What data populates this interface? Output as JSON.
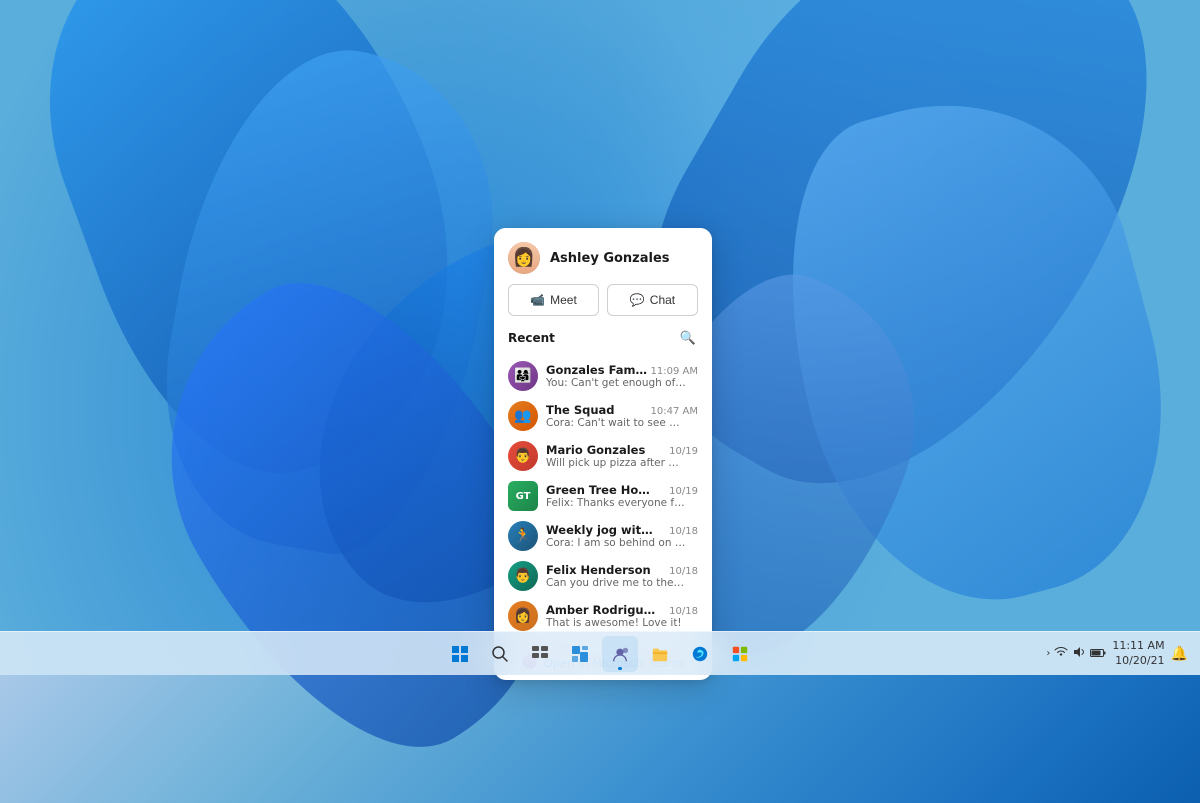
{
  "wallpaper": {
    "alt": "Windows 11 blue flower wallpaper"
  },
  "chatPanel": {
    "header": {
      "name": "Ashley Gonzales",
      "avatar": "👩"
    },
    "buttons": {
      "meet": "Meet",
      "chat": "Chat"
    },
    "recent": {
      "label": "Recent",
      "items": [
        {
          "id": "gonzales-family",
          "name": "Gonzales Family",
          "time": "11:09 AM",
          "preview": "You: Can't get enough of her.",
          "avatarClass": "av-family",
          "avatarText": "👨‍👩‍👧"
        },
        {
          "id": "the-squad",
          "name": "The Squad",
          "time": "10:47 AM",
          "preview": "Cora: Can't wait to see everyone!",
          "avatarClass": "av-squad",
          "avatarText": "👥"
        },
        {
          "id": "mario-gonzales",
          "name": "Mario Gonzales",
          "time": "10/19",
          "preview": "Will pick up pizza after my practice.",
          "avatarClass": "av-mario",
          "avatarText": "👨"
        },
        {
          "id": "green-tree",
          "name": "Green Tree House PTA",
          "time": "10/19",
          "preview": "Felix: Thanks everyone for attending today.",
          "avatarClass": "av-green",
          "avatarText": "GT"
        },
        {
          "id": "weekly-jog",
          "name": "Weekly jog with Cora",
          "time": "10/18",
          "preview": "Cora: I am so behind on my step goals.",
          "avatarClass": "av-weekly",
          "avatarText": "🏃"
        },
        {
          "id": "felix-henderson",
          "name": "Felix Henderson",
          "time": "10/18",
          "preview": "Can you drive me to the PTA today?",
          "avatarClass": "av-felix",
          "avatarText": "👨"
        },
        {
          "id": "amber-rodriguez",
          "name": "Amber Rodriguez",
          "time": "10/18",
          "preview": "That is awesome! Love it!",
          "avatarClass": "av-amber",
          "avatarText": "👩"
        }
      ]
    },
    "openTeams": "Open in Microsoft Teams"
  },
  "taskbar": {
    "icons": [
      {
        "id": "start",
        "symbol": "⊞",
        "label": "Start"
      },
      {
        "id": "search",
        "symbol": "🔍",
        "label": "Search"
      },
      {
        "id": "taskview",
        "symbol": "⧉",
        "label": "Task View"
      },
      {
        "id": "widgets",
        "symbol": "▦",
        "label": "Widgets"
      },
      {
        "id": "chat",
        "symbol": "💬",
        "label": "Chat"
      },
      {
        "id": "explorer",
        "symbol": "📁",
        "label": "File Explorer"
      },
      {
        "id": "edge",
        "symbol": "🌐",
        "label": "Edge"
      },
      {
        "id": "store",
        "symbol": "🏪",
        "label": "Store"
      }
    ],
    "systray": {
      "chevron": "›",
      "wifi": "📶",
      "volume": "🔊",
      "battery": "🔋"
    },
    "datetime": {
      "date": "10/20/21",
      "time": "11:11 AM"
    }
  }
}
